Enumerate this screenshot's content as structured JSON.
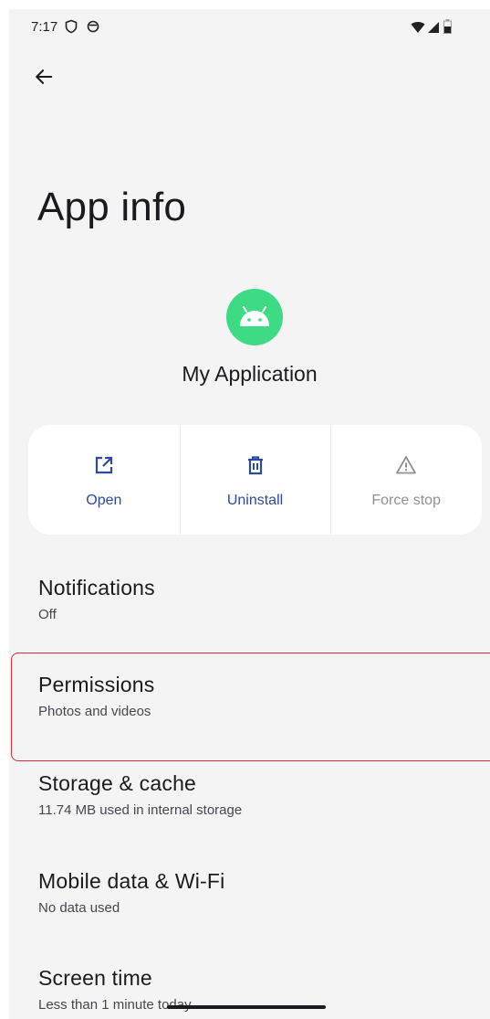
{
  "status_bar": {
    "time": "7:17",
    "icons": [
      "vpn-icon",
      "sync-icon",
      "wifi-icon",
      "cellular-icon",
      "battery-icon"
    ]
  },
  "header": {
    "back_icon": "back-arrow-icon",
    "title": "App info"
  },
  "app": {
    "name": "My Application",
    "icon": "android-icon",
    "icon_color": "#3ddc84"
  },
  "actions": [
    {
      "label": "Open",
      "icon": "open-external-icon",
      "enabled": true
    },
    {
      "label": "Uninstall",
      "icon": "trash-icon",
      "enabled": true
    },
    {
      "label": "Force stop",
      "icon": "warning-icon",
      "enabled": false
    }
  ],
  "settings": [
    {
      "title": "Notifications",
      "summary": "Off"
    },
    {
      "title": "Permissions",
      "summary": "Photos and videos",
      "highlighted": true
    },
    {
      "title": "Storage & cache",
      "summary": "11.74 MB used in internal storage"
    },
    {
      "title": "Mobile data & Wi-Fi",
      "summary": "No data used"
    },
    {
      "title": "Screen time",
      "summary": "Less than 1 minute today"
    }
  ],
  "colors": {
    "accent": "#2c4a9f",
    "disabled": "#8f9097",
    "background": "#f5f4f5",
    "highlight": "#e0283a"
  }
}
